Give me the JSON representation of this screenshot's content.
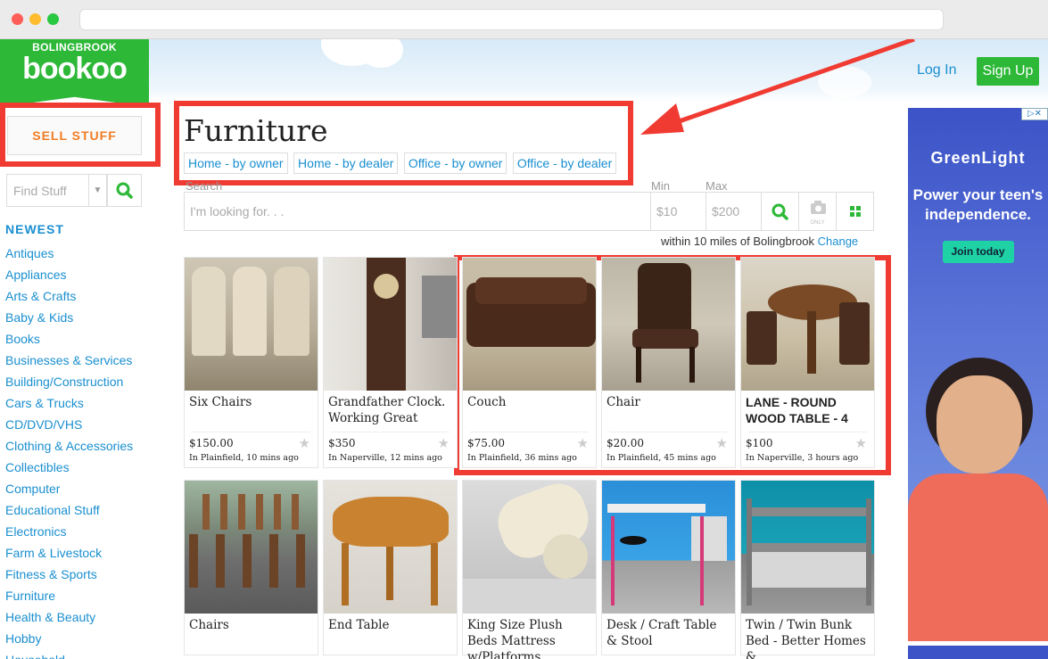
{
  "site": {
    "city": "BOLINGBROOK",
    "brand": "bookoo"
  },
  "header": {
    "login": "Log In",
    "signup": "Sign Up"
  },
  "sidebar": {
    "sell_label": "SELL STUFF",
    "find_placeholder": "Find Stuff",
    "newest_label": "NEWEST",
    "categories": [
      "Antiques",
      "Appliances",
      "Arts & Crafts",
      "Baby & Kids",
      "Books",
      "Businesses & Services",
      "Building/Construction",
      "Cars & Trucks",
      "CD/DVD/VHS",
      "Clothing & Accessories",
      "Collectibles",
      "Computer",
      "Educational Stuff",
      "Electronics",
      "Farm & Livestock",
      "Fitness & Sports",
      "Furniture",
      "Health & Beauty",
      "Hobby",
      "Household"
    ]
  },
  "main": {
    "title": "Furniture",
    "subcategories": [
      "Home - by owner",
      "Home - by dealer",
      "Office - by owner",
      "Office - by dealer"
    ],
    "search_label": "Search",
    "min_label": "Min",
    "max_label": "Max",
    "search_placeholder": "I'm looking for. . .",
    "min_placeholder": "$10",
    "max_placeholder": "$200",
    "camera_label": "ONLY",
    "within_text": "within 10 miles of Bolingbrook",
    "change_link": "Change"
  },
  "listings": [
    {
      "title": "Six Chairs",
      "price": "$150.00",
      "location": "In Plainfield, 10 mins ago"
    },
    {
      "title": "Grandfather Clock. Working Great",
      "price": "$350",
      "location": "In Naperville, 12 mins ago"
    },
    {
      "title": "Couch",
      "price": "$75.00",
      "location": "In Plainfield, 36 mins ago"
    },
    {
      "title": "Chair",
      "price": "$20.00",
      "location": "In Plainfield, 45 mins ago"
    },
    {
      "title": "LANE - ROUND WOOD TABLE - 4",
      "price": "$100",
      "location": "In Naperville, 3 hours ago"
    },
    {
      "title": "Chairs"
    },
    {
      "title": "End Table"
    },
    {
      "title": "King Size Plush Beds Mattress w/Platforms"
    },
    {
      "title": "Desk / Craft Table & Stool"
    },
    {
      "title": "Twin / Twin Bunk Bed - Better Homes &"
    }
  ],
  "ad": {
    "brand": "GreenLight",
    "tagline": "Power your teen's independence.",
    "cta": "Join today"
  },
  "colors": {
    "accent_green": "#2db838",
    "link_blue": "#1a8fd0",
    "annotation_red": "#f03b32",
    "sell_orange": "#f07c22"
  }
}
